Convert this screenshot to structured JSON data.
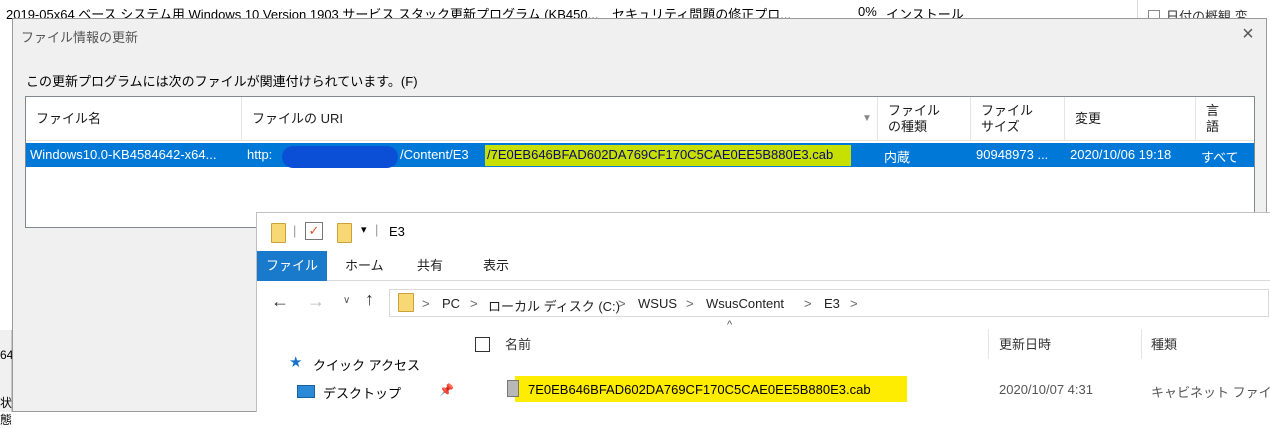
{
  "background": {
    "row_title": "2019-05x64 ベース システム用 Windows 10 Version 1903 サービス スタック更新プログラム (KB450...",
    "row_classification": "セキュリティ問題の修正プロ...",
    "row_progress": "0%",
    "row_status": "インストール",
    "right_pane_text": "日付の概観 変",
    "left_text_1": "64",
    "left_text_2": "状態"
  },
  "dialog": {
    "title": "ファイル情報の更新",
    "label": "この更新プログラムには次のファイルが関連付けられています。(F)",
    "columns": [
      {
        "label": "ファイル名"
      },
      {
        "label": "ファイルの URI"
      },
      {
        "label": "ファイル\nの種類"
      },
      {
        "label": "ファイル\nサイズ"
      },
      {
        "label": "変更"
      },
      {
        "label": "言\n語"
      }
    ],
    "row": {
      "filename": "Windows10.0-KB4584642-x64...",
      "uri_prefix": "http:",
      "uri_mid": "/Content/E3",
      "uri_highlight": "/7E0EB646BFAD602DA769CF170C5CAE0EE5B880E3.cab",
      "type": "内蔵",
      "size": "90948973 ...",
      "modified": "2020/10/06 19:18",
      "language": "すべて"
    }
  },
  "explorer": {
    "title": "E3",
    "tabs": {
      "file": "ファイル",
      "home": "ホーム",
      "share": "共有",
      "view": "表示"
    },
    "path": [
      "PC",
      "ローカル ディスク (C:)",
      "WSUS",
      "WsusContent",
      "E3"
    ],
    "nav_items": {
      "quick_access": "クイック アクセス",
      "desktop": "デスクトップ"
    },
    "columns": {
      "name": "名前",
      "date": "更新日時",
      "type": "種類"
    },
    "file": {
      "name": "7E0EB646BFAD602DA769CF170C5CAE0EE5B880E3.cab",
      "date": "2020/10/07 4:31",
      "type": "キャビネット ファイル"
    }
  },
  "colors": {
    "selection": "#0078d7",
    "highlight_green": "#c8e000",
    "highlight_yellow": "#ffed00",
    "file_tab": "#1979ca"
  }
}
